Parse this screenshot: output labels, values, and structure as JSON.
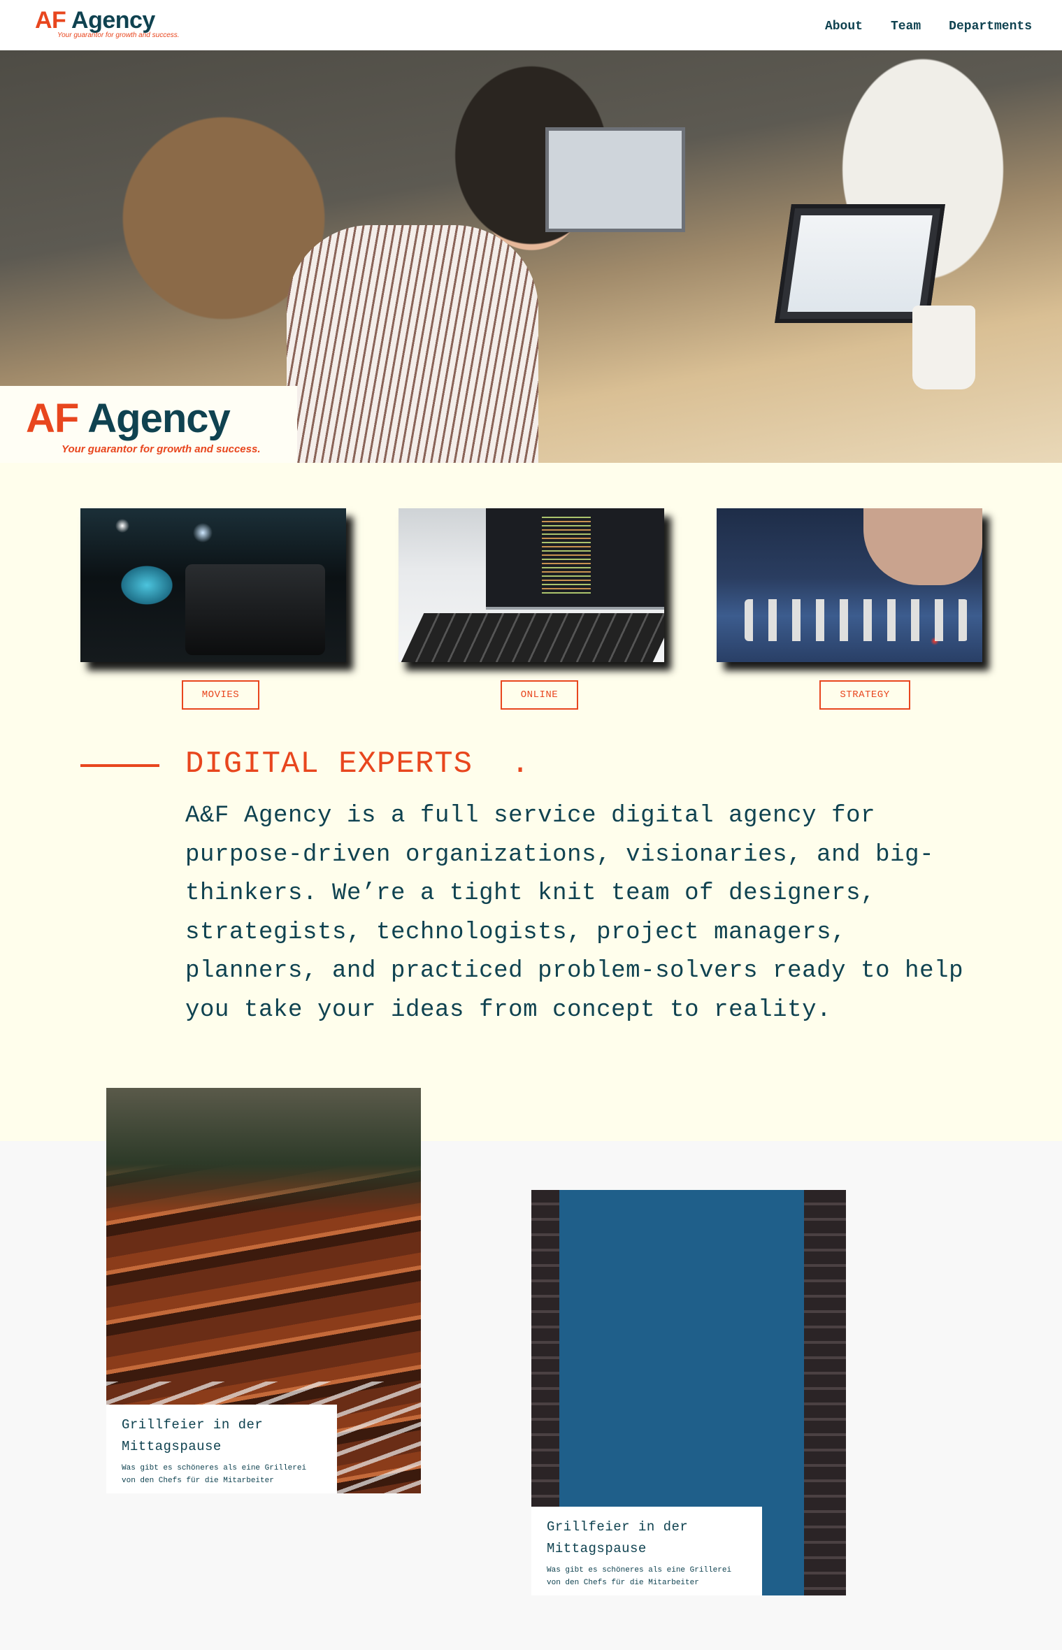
{
  "header": {
    "logo": {
      "af": "AF",
      "agency": " Agency",
      "tagline": "Your guarantor for growth and success."
    },
    "nav": [
      {
        "label": "About"
      },
      {
        "label": "Team"
      },
      {
        "label": "Departments"
      }
    ]
  },
  "hero": {
    "badge": {
      "af": "AF",
      "agency": " Agency",
      "tagline": "Your guarantor for growth and success."
    }
  },
  "services": [
    {
      "image_icon": "video-camera",
      "label": "MOVIES"
    },
    {
      "image_icon": "laptop-code",
      "label": "ONLINE"
    },
    {
      "image_icon": "chess",
      "label": "STRATEGY"
    }
  ],
  "intro": {
    "title": "DIGITAL EXPERTS  .",
    "text": "A&F Agency is a full service digital agency for purpose-driven organizations, visionaries, and big-thinkers. We’re a tight knit team of designers, strategists, technologists, project managers, planners, and practiced problem-solvers ready to help you take your ideas from concept to reality."
  },
  "events": [
    {
      "image_icon": "barbecue-grill",
      "title": "Grillfeier in der Mittagspause",
      "text": "Was gibt es schöneres als eine Grillerei von den Chefs für die Mitarbeiter"
    },
    {
      "image_icon": "astronomical-clock",
      "title": "Grillfeier in der Mittagspause",
      "text": "Was gibt es schöneres als eine Grillerei von den Chefs für die Mitarbeiter"
    }
  ],
  "colors": {
    "accent": "#e8461e",
    "primary": "#0f4250",
    "cream_bg": "#fffeec",
    "page_bg": "#f8f8f8"
  }
}
